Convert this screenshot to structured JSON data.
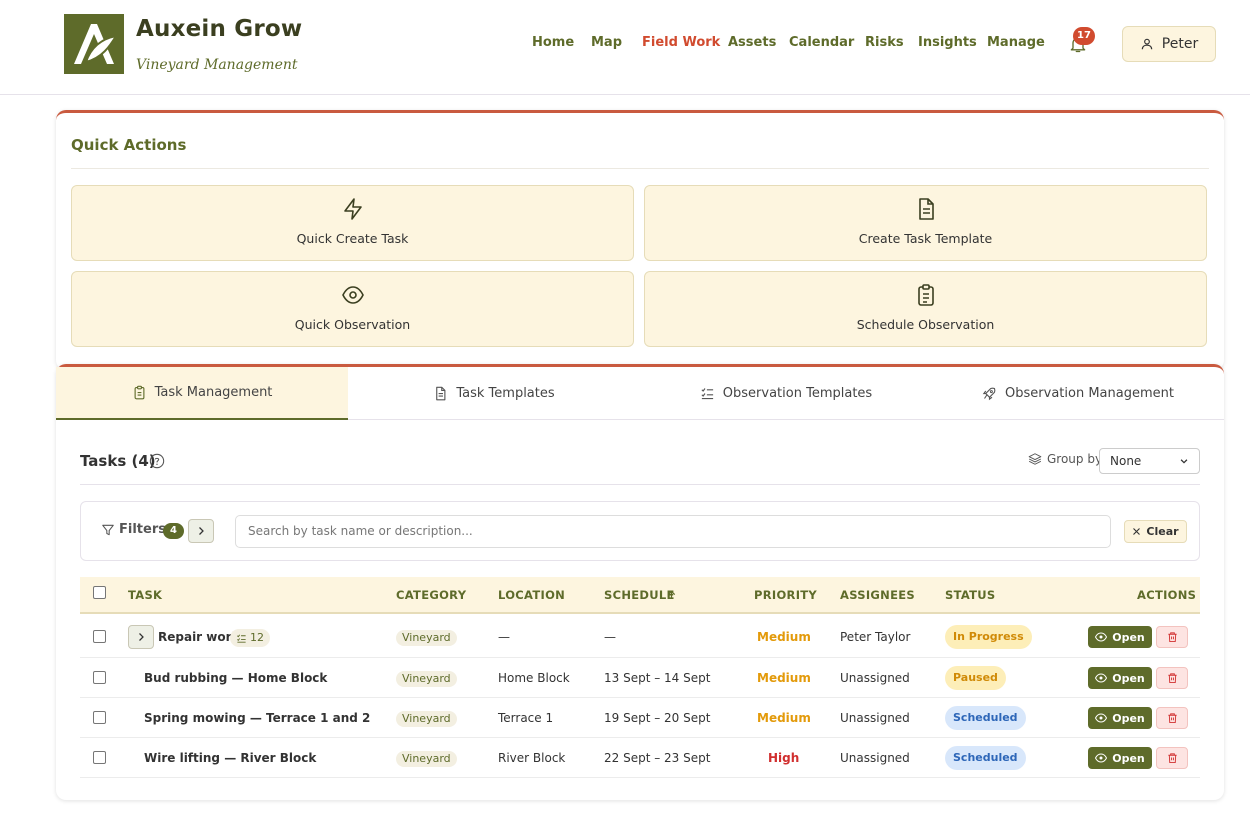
{
  "brand": {
    "name": "Auxein Grow",
    "subtitle": "Vineyard Management"
  },
  "nav": {
    "items": [
      "Home",
      "Map",
      "Field Work",
      "Assets",
      "Calendar",
      "Risks",
      "Insights",
      "Manage"
    ],
    "active": "Field Work"
  },
  "notifications": {
    "count": "17"
  },
  "user": {
    "name": "Peter"
  },
  "quick_actions": {
    "title": "Quick Actions",
    "buttons": [
      {
        "label": "Quick Create Task",
        "icon": "lightning-icon"
      },
      {
        "label": "Create Task Template",
        "icon": "document-icon"
      },
      {
        "label": "Quick Observation",
        "icon": "eye-icon"
      },
      {
        "label": "Schedule Observation",
        "icon": "clipboard-list-icon"
      }
    ]
  },
  "tabs": [
    {
      "label": "Task Management",
      "icon": "clipboard-icon",
      "active": true
    },
    {
      "label": "Task Templates",
      "icon": "document-icon",
      "active": false
    },
    {
      "label": "Observation Templates",
      "icon": "checklist-icon",
      "active": false
    },
    {
      "label": "Observation Management",
      "icon": "rocket-icon",
      "active": false
    }
  ],
  "tasks": {
    "title": "Tasks (4)",
    "group_by_label": "Group by",
    "group_by_value": "None",
    "filters_label": "Filters",
    "filters_count": "4",
    "search_placeholder": "Search by task name or description...",
    "clear_label": "Clear",
    "columns": [
      "TASK",
      "CATEGORY",
      "LOCATION",
      "SCHEDULE",
      "PRIORITY",
      "ASSIGNEES",
      "STATUS",
      "ACTIONS"
    ],
    "open_label": "Open",
    "rows": [
      {
        "task": "Repair work",
        "subtasks": "12",
        "category": "Vineyard",
        "location": "—",
        "schedule": "—",
        "priority": "Medium",
        "assignees": "Peter Taylor",
        "status": "In Progress"
      },
      {
        "task": "Bud rubbing — Home Block",
        "category": "Vineyard",
        "location": "Home Block",
        "schedule": "13 Sept – 14 Sept",
        "priority": "Medium",
        "assignees": "Unassigned",
        "status": "Paused"
      },
      {
        "task": "Spring mowing — Terrace 1 and 2",
        "category": "Vineyard",
        "location": "Terrace 1",
        "schedule": "19 Sept – 20 Sept",
        "priority": "Medium",
        "assignees": "Unassigned",
        "status": "Scheduled"
      },
      {
        "task": "Wire lifting — River Block",
        "category": "Vineyard",
        "location": "River Block",
        "schedule": "22 Sept – 23 Sept",
        "priority": "High",
        "assignees": "Unassigned",
        "status": "Scheduled"
      }
    ]
  },
  "colors": {
    "brand": "#5e6b2a",
    "accent": "#d14b2f",
    "cream": "#fdf5df",
    "medium": "#e39a0a",
    "high": "#d12f2f"
  }
}
